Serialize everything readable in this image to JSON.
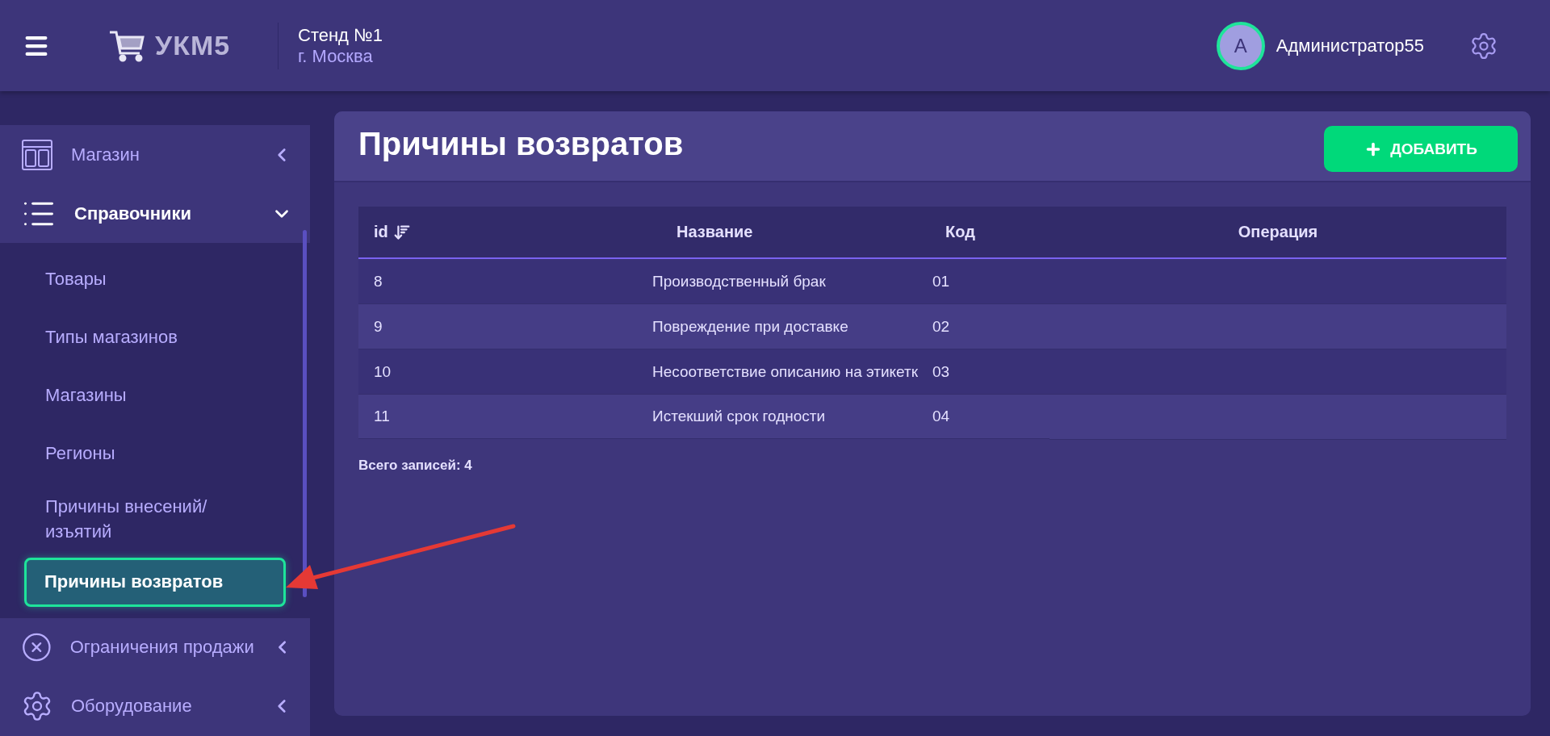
{
  "header": {
    "logo_text": "УКМ5",
    "stand": "Стенд №1",
    "city": "г. Москва",
    "avatar_letter": "А",
    "user": "Администратор55"
  },
  "sidebar": {
    "items": [
      {
        "label": "Магазин",
        "kind": "store",
        "expanded": false
      },
      {
        "label": "Справочники",
        "kind": "list",
        "expanded": true,
        "children": [
          {
            "label": "Товары",
            "selected": false
          },
          {
            "label": "Типы магазинов",
            "selected": false
          },
          {
            "label": "Магазины",
            "selected": false
          },
          {
            "label": "Регионы",
            "selected": false
          },
          {
            "label": "Причины внесений/ изъятий",
            "selected": false
          },
          {
            "label": "Причины возвратов",
            "selected": true
          }
        ]
      },
      {
        "label": "Ограничения продажи",
        "kind": "restrict",
        "expanded": false
      },
      {
        "label": "Оборудование",
        "kind": "gear",
        "expanded": false
      }
    ]
  },
  "page": {
    "title": "Причины возвратов",
    "add_button": "ДОБАВИТЬ"
  },
  "table": {
    "columns": [
      {
        "label": "id",
        "sorted": true
      },
      {
        "label": "Название",
        "sorted": false
      },
      {
        "label": "Код",
        "sorted": false
      },
      {
        "label": "Операция",
        "sorted": false
      }
    ],
    "rows": [
      [
        "8",
        "Производственный брак",
        "01"
      ],
      [
        "9",
        "Повреждение при доставке",
        "02"
      ],
      [
        "10",
        "Несоответствие описанию на этикетк",
        "03"
      ],
      [
        "11",
        "Истекший срок годности",
        "04"
      ]
    ]
  },
  "total": "Всего записей: 4"
}
